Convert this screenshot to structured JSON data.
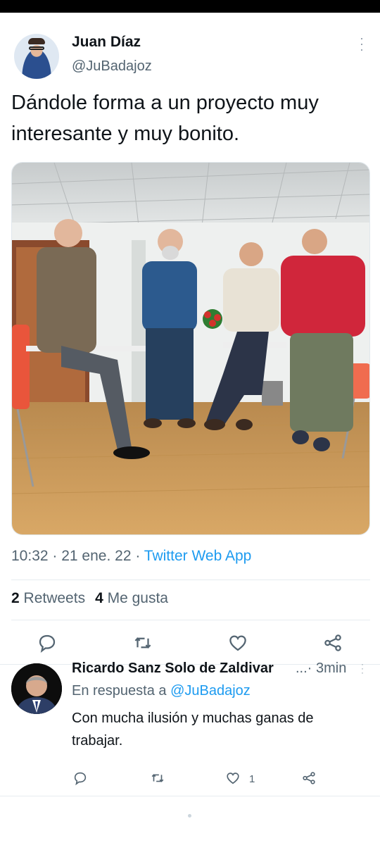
{
  "tweet": {
    "author_name": "Juan Díaz",
    "author_handle": "@JuBadajoz",
    "text": "Dándole forma a un proyecto muy interesante y muy bonito.",
    "time": "10:32",
    "date": "21 ene. 22",
    "separator": " · ",
    "source_app": "Twitter Web App",
    "retweets_count": "2",
    "retweets_label": "Retweets",
    "likes_count": "4",
    "likes_label": "Me gusta"
  },
  "reply": {
    "author_name": "Ricardo Sanz Solo de Zaldivar",
    "ellipsis": "...·",
    "time": "3min",
    "reply_to_label": "En respuesta a",
    "reply_to_handle": "@JuBadajoz",
    "text": "Con mucha ilusión y muchas ganas de trabajar.",
    "like_count": "1"
  },
  "icons": {
    "more": "more-vertical-icon",
    "reply": "reply-icon",
    "retweet": "retweet-icon",
    "like": "heart-icon",
    "share": "share-icon"
  },
  "colors": {
    "link": "#1d9bf0",
    "muted": "#536471",
    "text": "#0f1419"
  }
}
